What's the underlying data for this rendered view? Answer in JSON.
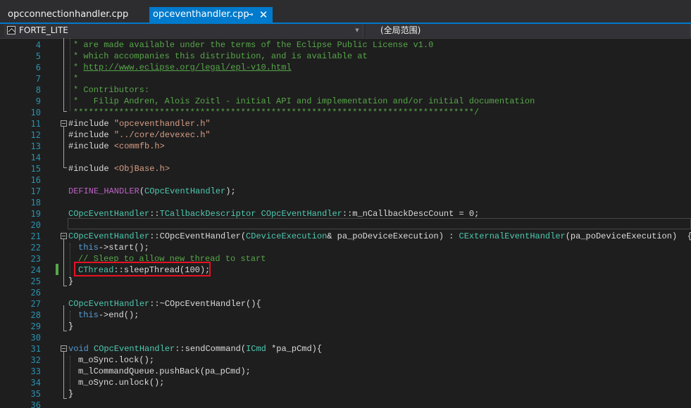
{
  "tabs": [
    {
      "label": "opcconnectionhandler.cpp",
      "active": false
    },
    {
      "label": "opceventhandler.cpp",
      "active": true,
      "pin_icon": "pin-icon",
      "close_icon": "close-icon"
    }
  ],
  "navbar": {
    "project": "FORTE_LITE",
    "scope": "(全局范围)"
  },
  "colors": {
    "accent": "#007acc",
    "comment": "#57a64a",
    "string": "#d69d85",
    "keyword": "#569cd6",
    "type": "#4ec9b0",
    "macro": "#bd63c5",
    "line_number": "#2b91af",
    "highlight_border": "#e81123"
  },
  "code": {
    "lines": [
      {
        "n": "4",
        "t": "* are made available under the terms of the Eclipse Public License v1.0"
      },
      {
        "n": "5",
        "t": "* which accompanies this distribution, and is available at"
      },
      {
        "n": "6",
        "t1": "* ",
        "url": "http://www.eclipse.org/legal/epl-v10.html"
      },
      {
        "n": "7",
        "t": "*"
      },
      {
        "n": "8",
        "t": "* Contributors:"
      },
      {
        "n": "9",
        "t": "*   Filip Andren, Alois Zoitl - initial API and implementation and/or initial documentation"
      },
      {
        "n": "10",
        "t": "*******************************************************************************/"
      },
      {
        "n": "11",
        "a": "#include ",
        "b": "\"opceventhandler.h\""
      },
      {
        "n": "12",
        "a": "#include ",
        "b": "\"../core/devexec.h\""
      },
      {
        "n": "13",
        "a": "#include ",
        "b": "<commfb.h>"
      },
      {
        "n": "14"
      },
      {
        "n": "15",
        "a": "#include ",
        "b": "<ObjBase.h>"
      },
      {
        "n": "16"
      },
      {
        "n": "17",
        "a": "DEFINE_HANDLER",
        "b": "(",
        "c": "COpcEventHandler",
        "d": ");"
      },
      {
        "n": "18"
      },
      {
        "n": "19",
        "a": "COpcEventHandler",
        "b": "::",
        "c": "TCallbackDescriptor",
        "d": " ",
        "e": "COpcEventHandler",
        "f": "::m_nCallbackDescCount = 0;"
      },
      {
        "n": "20"
      },
      {
        "n": "21",
        "a": "COpcEventHandler",
        "b": "::COpcEventHandler(",
        "c": "CDeviceExecution",
        "d": "& pa_poDeviceExecution) : ",
        "e": "CExternalEventHandler",
        "f": "(pa_poDeviceExecution)  {"
      },
      {
        "n": "22",
        "a": "this",
        "b": "->start();"
      },
      {
        "n": "23",
        "t": "// Sleep to allow new thread to start"
      },
      {
        "n": "24",
        "a": "CThread",
        "b": "::sleepThread(100);"
      },
      {
        "n": "25",
        "t": "}"
      },
      {
        "n": "26"
      },
      {
        "n": "27",
        "a": "COpcEventHandler",
        "b": "::~COpcEventHandler(){"
      },
      {
        "n": "28",
        "a": "this",
        "b": "->end();"
      },
      {
        "n": "29",
        "t": "}"
      },
      {
        "n": "30"
      },
      {
        "n": "31",
        "a": "void",
        "b": " ",
        "c": "COpcEventHandler",
        "d": "::sendCommand(",
        "e": "ICmd",
        "f": " *pa_pCmd){"
      },
      {
        "n": "32",
        "t": "m_oSync.lock();"
      },
      {
        "n": "33",
        "t": "m_lCommandQueue.pushBack(pa_pCmd);"
      },
      {
        "n": "34",
        "t": "m_oSync.unlock();"
      },
      {
        "n": "35",
        "t": "}"
      },
      {
        "n": "36"
      }
    ]
  }
}
